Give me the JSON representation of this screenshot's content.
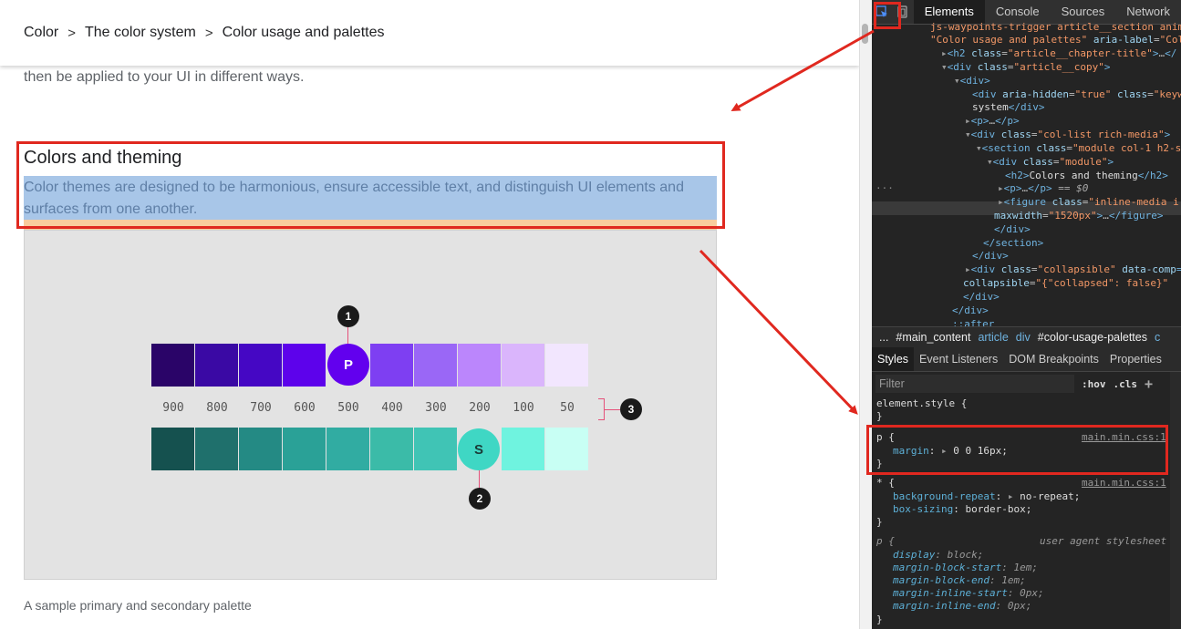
{
  "breadcrumb": {
    "items": [
      "Color",
      "The color system",
      "Color usage and palettes"
    ],
    "separator": ">"
  },
  "article": {
    "intro": "then be applied to your UI in different ways.",
    "heading": "Colors and theming",
    "paragraph": "Color themes are designed to be harmonious, ensure accessible text, and distinguish UI elements and surfaces from one another.",
    "caption": "A sample primary and secondary palette"
  },
  "palette": {
    "primary_colors": [
      "#2a0468",
      "#3a09a4",
      "#4507c4",
      "#5d02eb",
      "#6200ee",
      "#7e3ff2",
      "#9a67f6",
      "#bb86fc",
      "#dab5fc",
      "#f2e6fe"
    ],
    "secondary_colors": [
      "#15514f",
      "#1f706c",
      "#248a84",
      "#2aa197",
      "#31aca2",
      "#3bbba8",
      "#40c4b5",
      "#03dac6",
      "#6ff3df",
      "#c8fff4"
    ],
    "labels": [
      "900",
      "800",
      "700",
      "600",
      "500",
      "400",
      "300",
      "200",
      "100",
      "50"
    ],
    "primary_badge": "P",
    "secondary_badge": "S",
    "primary_badge_color": "#6200ee",
    "secondary_badge_color": "#3fd7c4",
    "callouts": [
      "1",
      "2",
      "3"
    ]
  },
  "devtools": {
    "tabs": [
      "Elements",
      "Console",
      "Sources",
      "Network"
    ],
    "active_tab": "Elements",
    "crumbs": [
      "...",
      "#main_content",
      "article",
      "div",
      "#color-usage-palettes",
      "c"
    ],
    "subtabs": [
      "Styles",
      "Event Listeners",
      "DOM Breakpoints",
      "Properties"
    ],
    "filter_placeholder": "Filter",
    "hov": ":hov",
    "cls": ".cls",
    "plus": "+",
    "styles": {
      "element_style": "element.style {",
      "close": "}",
      "rule1_selector": "p {",
      "rule1_prop": "margin",
      "rule1_value": "0 0 16px;",
      "rule1_source": "main.min.css:1",
      "rule2_selector": "* {",
      "rule2_source": "main.min.css:1",
      "rule2_prop1": "background-repeat",
      "rule2_val1": "no-repeat;",
      "rule2_prop2": "box-sizing",
      "rule2_val2": "border-box;",
      "ua_selector": "p {",
      "ua_label": "user agent stylesheet",
      "ua_props": [
        {
          "p": "display",
          "v": "block;"
        },
        {
          "p": "margin-block-start",
          "v": "1em;"
        },
        {
          "p": "margin-block-end",
          "v": "1em;"
        },
        {
          "p": "margin-inline-start",
          "v": "0px;"
        },
        {
          "p": "margin-inline-end",
          "v": "0px;"
        }
      ]
    },
    "dom": {
      "l1": "js-waypoints-trigger article__section anim",
      "l2a": "\"Color usage and palettes\"",
      "l2b": "aria-label",
      "l2c": "\"Col",
      "l3": "\"article__chapter-title\"",
      "l4": "\"article__copy\"",
      "l6a": "\"true\"",
      "l6b": "\"keyw",
      "l7": "system",
      "l9": "\"col-list rich-media\"",
      "l10a": "\"module col-1 h2-s",
      "l11": "\"module\"",
      "l12": "Colors and theming",
      "l13": "== $0",
      "l14": "\"inline-media i",
      "l15": "\"1520px\"",
      "l19a": "\"collapsible\"",
      "l19b": "data-comp",
      "l20a": "collapsible",
      "l20b": "\"{\"collapsed\": false}\"",
      "l22": "::after"
    }
  }
}
